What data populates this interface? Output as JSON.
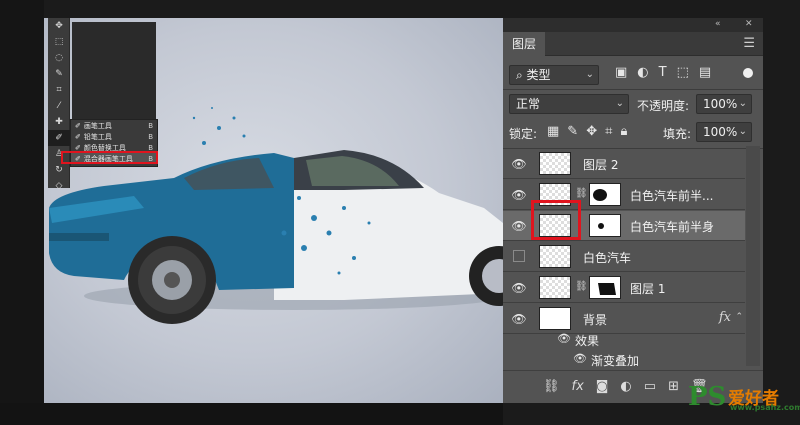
{
  "tool_flyout": [
    {
      "label": "画笔工具",
      "key": "B"
    },
    {
      "label": "铅笔工具",
      "key": "B"
    },
    {
      "label": "颜色替换工具",
      "key": "B"
    },
    {
      "label": "混合器画笔工具",
      "key": "B",
      "active": true
    }
  ],
  "panel": {
    "tab": "图层",
    "filter_kind": "类型",
    "blend_mode": "正常",
    "opacity_label": "不透明度:",
    "opacity_value": "100%",
    "lock_label": "锁定:",
    "fill_label": "填充:",
    "fill_value": "100%"
  },
  "layers": [
    {
      "name": "图层 2",
      "visible": true,
      "mask": false
    },
    {
      "name": "白色汽车前半...",
      "visible": true,
      "mask": true
    },
    {
      "name": "白色汽车前半身",
      "visible": true,
      "mask": true,
      "selected": true
    },
    {
      "name": "白色汽车",
      "visible": false,
      "mask": false
    },
    {
      "name": "图层 1",
      "visible": true,
      "mask": true
    },
    {
      "name": "背景",
      "visible": true,
      "mask": false,
      "fx": "fx"
    }
  ],
  "effects": {
    "label": "效果",
    "item": "渐变叠加"
  },
  "watermark": {
    "logo": "PS",
    "text": "爱好者",
    "url": "www.psahz.com"
  }
}
